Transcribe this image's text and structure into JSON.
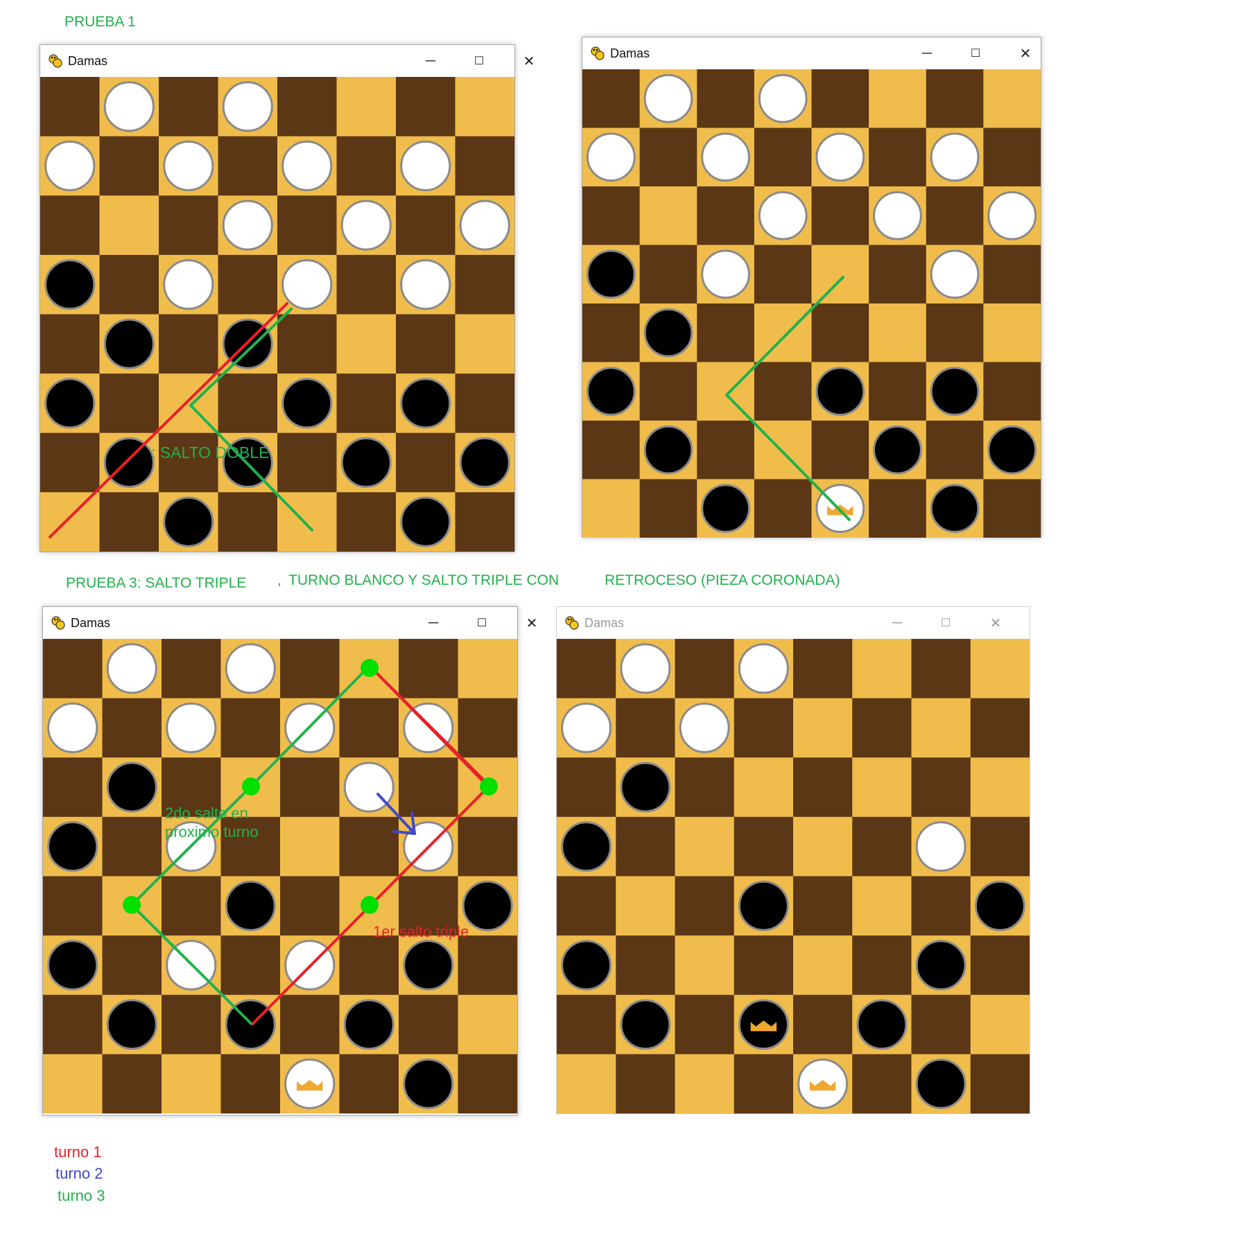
{
  "labels": {
    "prueba1": "PRUEBA 1",
    "prueba3": "PRUEBA 3: SALTO TRIPLE",
    "prueba3_sep": ",",
    "prueba3_rest": "TURNO BLANCO Y SALTO TRIPLE CON",
    "prueba3_end": "RETROCESO (PIEZA CORONADA)",
    "salto_doble": ": SALTO DOBLE",
    "segundo_salto_1": "2do salto en",
    "segundo_salto_2": "proximo turno",
    "primer_salto": "1er salto triple",
    "turno1": "turno 1",
    "turno2": "turno 2",
    "turno3": "turno 3"
  },
  "colors": {
    "dark_square": "#5c3715",
    "light_square": "#f0bd4c",
    "white_piece": "#ffffff",
    "black_piece": "#000000",
    "piece_border": "#8a8a8a",
    "crown": "#f0a830",
    "annot_red": "#e8202a",
    "annot_green": "#22b14c",
    "annot_blue": "#3f48cc",
    "marker_green": "#00e000"
  },
  "windows": [
    {
      "title": "Damas",
      "active": true,
      "minimize": "─",
      "maximize": "☐",
      "close": "✕",
      "board": [
        ".W.W....",
        "W.W.W.W.",
        "...W.W.W",
        "B.W.W.W.",
        ".B.B....",
        "B...B.B.",
        ".B.B.B.B",
        "..B...B."
      ]
    },
    {
      "title": "Damas",
      "active": true,
      "minimize": "─",
      "maximize": "☐",
      "close": "✕",
      "board": [
        ".W.W....",
        "W.W.W.W.",
        "...W.W.W",
        "B.W...W.",
        ".B......",
        "B...B.B.",
        ".B...B.B",
        "..B.K.B."
      ]
    },
    {
      "title": "Damas",
      "active": true,
      "minimize": "─",
      "maximize": "☐",
      "close": "✕",
      "board": [
        ".W.W....",
        "W.W.W.W.",
        ".B...W..",
        "B.W...W.",
        "...B...B",
        "B.W.W.B.",
        ".B.B.B..",
        "....K.B."
      ]
    },
    {
      "title": "Damas",
      "active": false,
      "minimize": "─",
      "maximize": "☐",
      "close": "✕",
      "board": [
        ".W.W....",
        "W.W.....",
        ".B......",
        "B.....W.",
        "...B...B",
        "B.....B.",
        ".B.Q.B..",
        "....K.B."
      ]
    }
  ]
}
